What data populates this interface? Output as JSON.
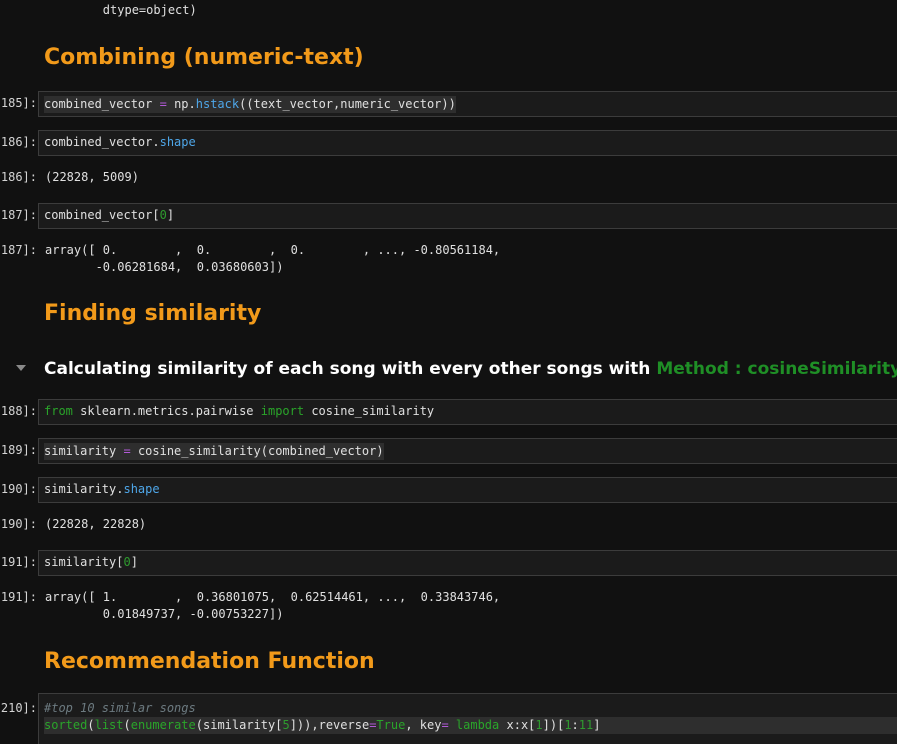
{
  "top_output": "        dtype=object)",
  "headings": {
    "combining": "Combining (numeric-text)",
    "finding": "Finding similarity",
    "calc_prefix": "Calculating similarity of each song with every other songs with",
    "calc_method": "Method : cosineSimilarity",
    "calc_anchor": "¶",
    "recommendation": "Recommendation Function"
  },
  "cells": {
    "c185": {
      "prompt": "185]:",
      "t1": "combined_vector",
      "t2": " = ",
      "t3": "np.",
      "t4": "hstack",
      "t5": "((text_vector,numeric_vector))"
    },
    "c186": {
      "prompt": "186]:",
      "t1": "combined_vector.",
      "t2": "shape",
      "out_prompt": "186]:",
      "out": "(22828, 5009)"
    },
    "c187": {
      "prompt": "187]:",
      "t1": "combined_vector[",
      "t2": "0",
      "t3": "]",
      "out_prompt": "187]:",
      "out1": "array([ 0.        ,  0.        ,  0.        , ..., -0.80561184,",
      "out2": "       -0.06281684,  0.03680603])"
    },
    "c188": {
      "prompt": "188]:",
      "t1": "from",
      "t2": " sklearn.metrics.pairwise ",
      "t3": "import",
      "t4": " cosine_similarity"
    },
    "c189": {
      "prompt": "189]:",
      "t1": "similarity",
      "t2": " = ",
      "t3": "cosine_similarity(combined_vector)"
    },
    "c190": {
      "prompt": "190]:",
      "t1": "similarity.",
      "t2": "shape",
      "out_prompt": "190]:",
      "out": "(22828, 22828)"
    },
    "c191": {
      "prompt": "191]:",
      "t1": "similarity[",
      "t2": "0",
      "t3": "]",
      "out_prompt": "191]:",
      "out1": "array([ 1.        ,  0.36801075,  0.62514461, ...,  0.33843746,",
      "out2": "        0.01849737, -0.00753227])"
    },
    "c210": {
      "prompt": "210]:",
      "comment": "#top 10 similar songs",
      "t1": "sorted",
      "t2": "(",
      "t3": "list",
      "t4": "(",
      "t5": "enumerate",
      "t6": "(similarity[",
      "t7": "5",
      "t8": "])),reverse",
      "t9": "=",
      "t10": "True",
      "t11": ", key",
      "t12": "=",
      "t13": " lambda",
      "t14": " x:x[",
      "t15": "1",
      "t16": "])[",
      "t17": "1",
      "t18": ":",
      "t19": "11",
      "t20": "]"
    }
  },
  "colors": {
    "background": "#111111",
    "heading_orange": "#f29a1a",
    "method_green": "#1f8f26",
    "anchor_blue": "#3a8ee6"
  }
}
